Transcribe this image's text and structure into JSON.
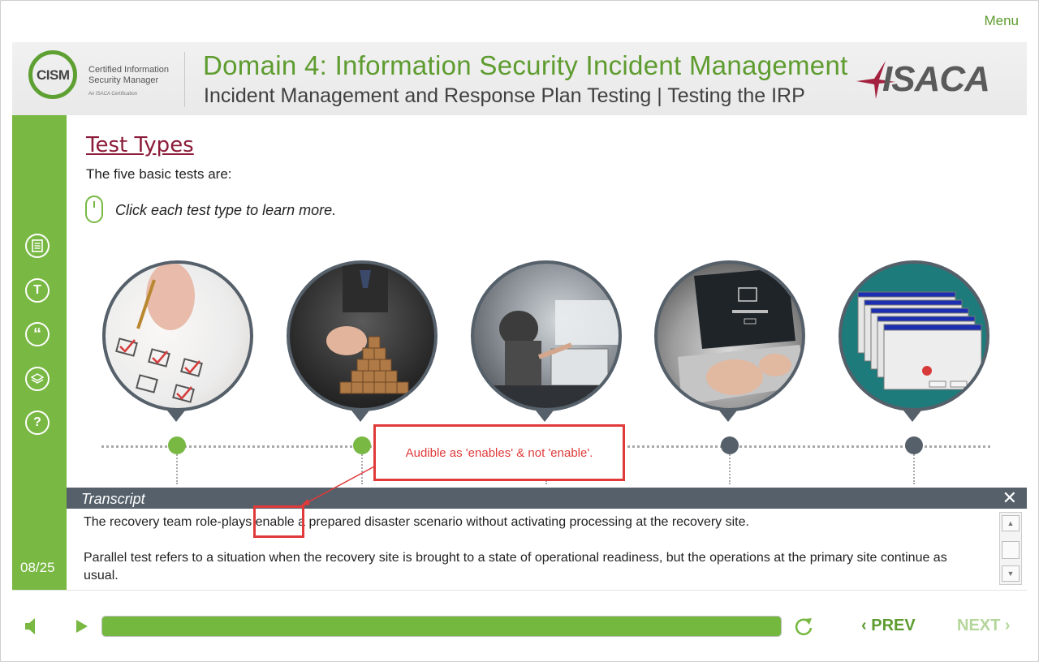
{
  "menu_label": "Menu",
  "colors": {
    "accent": "#78b843",
    "title_green": "#5e9c2f",
    "section_title": "#8c1c3a",
    "annotation_red": "#e03a3a",
    "dark_bar": "#55606a"
  },
  "header": {
    "cism_logo": {
      "word": "CISM",
      "line1": "Certified Information",
      "line2": "Security Manager",
      "line3": "An ISACA Certification"
    },
    "title": "Domain 4: Information Security Incident Management",
    "subtitle": "Incident Management and Response Plan Testing | Testing the IRP",
    "isaca_logo": "ISACA"
  },
  "sidebar": {
    "icons": [
      "notes-icon",
      "text-icon",
      "quote-icon",
      "layers-icon",
      "help-icon"
    ],
    "text_icon_glyph": "T",
    "quote_icon_glyph": "“",
    "help_icon_glyph": "?",
    "slide_number": "08/25"
  },
  "content": {
    "section_title": "Test Types",
    "intro": "The five basic tests are:",
    "instruction": "Click each test type to learn more."
  },
  "test_types": [
    {
      "image": "checklist-image",
      "visited": true
    },
    {
      "image": "block-stacking-image",
      "visited": true
    },
    {
      "image": "simulation-image",
      "visited": false
    },
    {
      "image": "laptop-operating-system-image",
      "visited": false
    },
    {
      "image": "error-windows-image",
      "visited": false
    }
  ],
  "annotation": {
    "text": "Audible as 'enables' & not 'enable'."
  },
  "transcript": {
    "title": "Transcript",
    "close_glyph": "✕",
    "paragraph1": "The recovery team role-plays enable a prepared disaster scenario without activating processing at the recovery site.",
    "paragraph2": "Parallel test refers to a situation when the recovery site is brought to a state of operational readiness, but the operations at the primary site continue as usual."
  },
  "footer": {
    "progress_fraction": 1.0,
    "prev_label": "PREV",
    "next_label": "NEXT",
    "prev_glyph": "‹",
    "next_glyph": "›"
  }
}
